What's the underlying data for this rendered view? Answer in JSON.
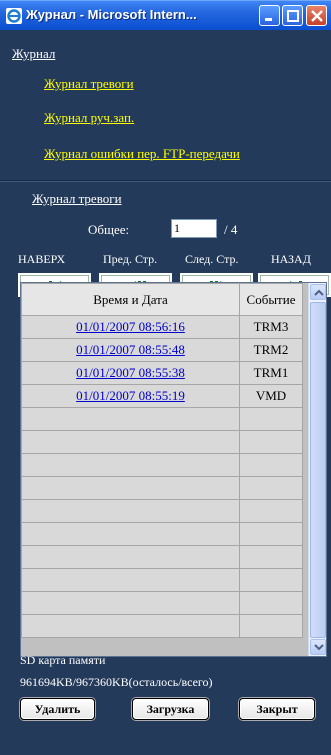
{
  "window": {
    "title": "Журнал - Microsoft Intern..."
  },
  "page": {
    "section_title": "Журнал",
    "links": [
      "Журнал тревоги",
      "Журнал руч.зап.",
      "Журнал ошибки пер. FTP-передачи"
    ],
    "subsection_title": "Журнал тревоги",
    "total_label": "Общее:",
    "page_input_value": "1",
    "page_total": "/ 4",
    "nav": {
      "first_label": "НАВЕРХ",
      "prev_label": "Пред. Стр.",
      "next_label": "След. Стр.",
      "last_label": "НАЗАД"
    },
    "table": {
      "headers": [
        "Время и Дата",
        "Событие"
      ],
      "rows": [
        {
          "datetime": "01/01/2007 08:56:16",
          "event": "TRM3"
        },
        {
          "datetime": "01/01/2007 08:55:48",
          "event": "TRM2"
        },
        {
          "datetime": "01/01/2007 08:55:38",
          "event": "TRM1"
        },
        {
          "datetime": "01/01/2007 08:55:19",
          "event": "VMD"
        }
      ]
    },
    "sd_label": "SD карта памяти",
    "sd_value": "961694KB/967360KB(осталось/всего)",
    "buttons": {
      "delete": "Удалить",
      "download": "Загрузка",
      "close": "Закрыт"
    }
  },
  "colors": {
    "background": "#243a5a",
    "link": "#ffff00",
    "table_link": "#0000cc",
    "nav_icon": "#0a7a2a"
  },
  "icons": [
    "internet-explorer-icon",
    "minimize-icon",
    "maximize-icon",
    "close-icon",
    "first-page-icon",
    "prev-page-icon",
    "next-page-icon",
    "last-page-icon",
    "scroll-up-icon",
    "scroll-down-icon"
  ]
}
